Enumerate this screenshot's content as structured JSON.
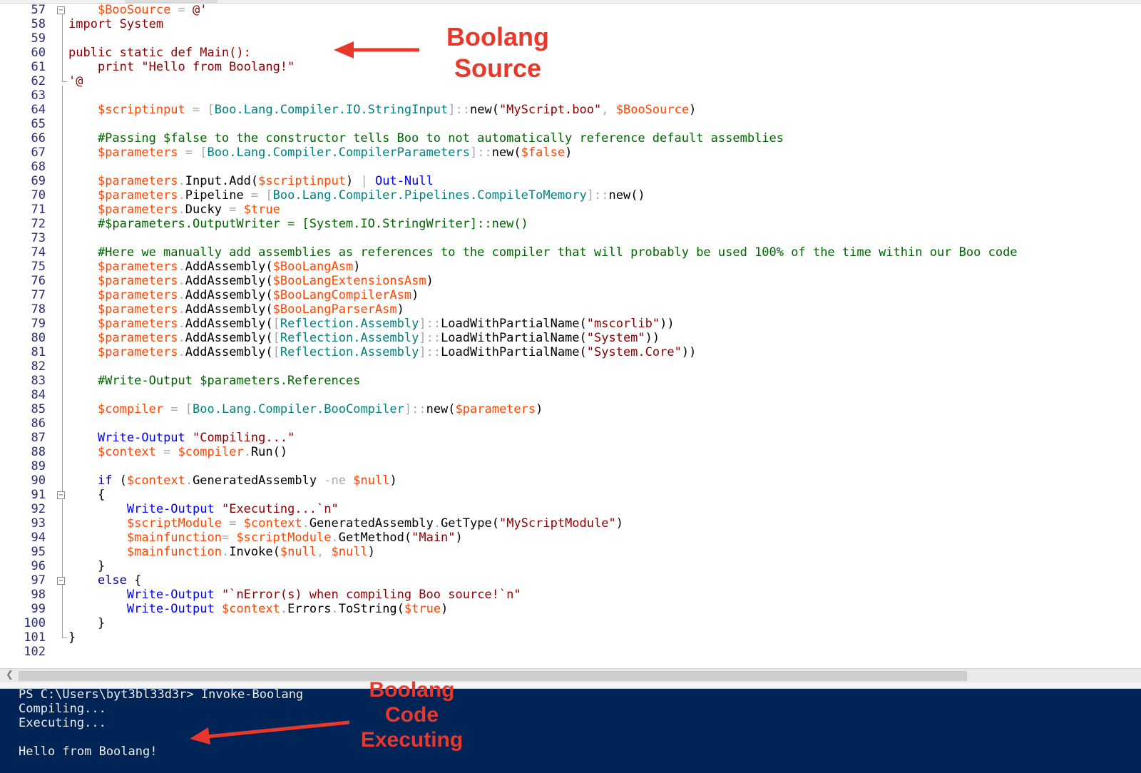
{
  "editor": {
    "line_numbers": [
      "57",
      "58",
      "59",
      "60",
      "61",
      "62",
      "63",
      "64",
      "65",
      "66",
      "67",
      "68",
      "69",
      "70",
      "71",
      "72",
      "73",
      "74",
      "75",
      "76",
      "77",
      "78",
      "79",
      "80",
      "81",
      "82",
      "83",
      "84",
      "85",
      "86",
      "87",
      "88",
      "89",
      "90",
      "91",
      "92",
      "93",
      "94",
      "95",
      "96",
      "97",
      "98",
      "99",
      "100",
      "101",
      "102"
    ],
    "lines": [
      [
        [
          "    ",
          "m"
        ],
        [
          "$BooSource",
          "v"
        ],
        [
          " = ",
          "o"
        ],
        [
          "@'",
          "s"
        ]
      ],
      [
        [
          "import System",
          "s"
        ]
      ],
      [
        [
          "",
          "m"
        ]
      ],
      [
        [
          "public static def Main():",
          "s"
        ]
      ],
      [
        [
          "    print \"Hello from Boolang!\"",
          "s"
        ]
      ],
      [
        [
          "'@",
          "s"
        ]
      ],
      [
        [
          "",
          "m"
        ]
      ],
      [
        [
          "    ",
          "m"
        ],
        [
          "$scriptinput",
          "v"
        ],
        [
          " = ",
          "o"
        ],
        [
          "[",
          "o"
        ],
        [
          "Boo.Lang.Compiler.IO.StringInput",
          "t"
        ],
        [
          "]::",
          "o"
        ],
        [
          "new(",
          "m"
        ],
        [
          "\"MyScript.boo\"",
          "s"
        ],
        [
          ", ",
          "o"
        ],
        [
          "$BooSource",
          "v"
        ],
        [
          ")",
          "m"
        ]
      ],
      [
        [
          "",
          "m"
        ]
      ],
      [
        [
          "    #Passing $false to the constructor tells Boo to not automatically reference default assemblies",
          "c"
        ]
      ],
      [
        [
          "    ",
          "m"
        ],
        [
          "$parameters",
          "v"
        ],
        [
          " = ",
          "o"
        ],
        [
          "[",
          "o"
        ],
        [
          "Boo.Lang.Compiler.CompilerParameters",
          "t"
        ],
        [
          "]::",
          "o"
        ],
        [
          "new(",
          "m"
        ],
        [
          "$false",
          "v"
        ],
        [
          ")",
          "m"
        ]
      ],
      [
        [
          "",
          "m"
        ]
      ],
      [
        [
          "    ",
          "m"
        ],
        [
          "$parameters",
          "v"
        ],
        [
          ".",
          "o"
        ],
        [
          "Input.Add(",
          "m"
        ],
        [
          "$scriptinput",
          "v"
        ],
        [
          ")",
          "m"
        ],
        [
          " | ",
          "o"
        ],
        [
          "Out-Null",
          "cm"
        ]
      ],
      [
        [
          "    ",
          "m"
        ],
        [
          "$parameters",
          "v"
        ],
        [
          ".",
          "o"
        ],
        [
          "Pipeline",
          "m"
        ],
        [
          " = ",
          "o"
        ],
        [
          "[",
          "o"
        ],
        [
          "Boo.Lang.Compiler.Pipelines.CompileToMemory",
          "t"
        ],
        [
          "]::",
          "o"
        ],
        [
          "new()",
          "m"
        ]
      ],
      [
        [
          "    ",
          "m"
        ],
        [
          "$parameters",
          "v"
        ],
        [
          ".",
          "o"
        ],
        [
          "Ducky",
          "m"
        ],
        [
          " = ",
          "o"
        ],
        [
          "$true",
          "v"
        ]
      ],
      [
        [
          "    #$parameters.OutputWriter = [System.IO.StringWriter]::new()",
          "c"
        ]
      ],
      [
        [
          "",
          "m"
        ]
      ],
      [
        [
          "    #Here we manually add assemblies as references to the compiler that will probably be used 100% of the time within our Boo code",
          "c"
        ]
      ],
      [
        [
          "    ",
          "m"
        ],
        [
          "$parameters",
          "v"
        ],
        [
          ".",
          "o"
        ],
        [
          "AddAssembly(",
          "m"
        ],
        [
          "$BooLangAsm",
          "v"
        ],
        [
          ")",
          "m"
        ]
      ],
      [
        [
          "    ",
          "m"
        ],
        [
          "$parameters",
          "v"
        ],
        [
          ".",
          "o"
        ],
        [
          "AddAssembly(",
          "m"
        ],
        [
          "$BooLangExtensionsAsm",
          "v"
        ],
        [
          ")",
          "m"
        ]
      ],
      [
        [
          "    ",
          "m"
        ],
        [
          "$parameters",
          "v"
        ],
        [
          ".",
          "o"
        ],
        [
          "AddAssembly(",
          "m"
        ],
        [
          "$BooLangCompilerAsm",
          "v"
        ],
        [
          ")",
          "m"
        ]
      ],
      [
        [
          "    ",
          "m"
        ],
        [
          "$parameters",
          "v"
        ],
        [
          ".",
          "o"
        ],
        [
          "AddAssembly(",
          "m"
        ],
        [
          "$BooLangParserAsm",
          "v"
        ],
        [
          ")",
          "m"
        ]
      ],
      [
        [
          "    ",
          "m"
        ],
        [
          "$parameters",
          "v"
        ],
        [
          ".",
          "o"
        ],
        [
          "AddAssembly(",
          "m"
        ],
        [
          "[",
          "o"
        ],
        [
          "Reflection.Assembly",
          "t"
        ],
        [
          "]::",
          "o"
        ],
        [
          "LoadWithPartialName(",
          "m"
        ],
        [
          "\"mscorlib\"",
          "s"
        ],
        [
          "))",
          "m"
        ]
      ],
      [
        [
          "    ",
          "m"
        ],
        [
          "$parameters",
          "v"
        ],
        [
          ".",
          "o"
        ],
        [
          "AddAssembly(",
          "m"
        ],
        [
          "[",
          "o"
        ],
        [
          "Reflection.Assembly",
          "t"
        ],
        [
          "]::",
          "o"
        ],
        [
          "LoadWithPartialName(",
          "m"
        ],
        [
          "\"System\"",
          "s"
        ],
        [
          "))",
          "m"
        ]
      ],
      [
        [
          "    ",
          "m"
        ],
        [
          "$parameters",
          "v"
        ],
        [
          ".",
          "o"
        ],
        [
          "AddAssembly(",
          "m"
        ],
        [
          "[",
          "o"
        ],
        [
          "Reflection.Assembly",
          "t"
        ],
        [
          "]::",
          "o"
        ],
        [
          "LoadWithPartialName(",
          "m"
        ],
        [
          "\"System.Core\"",
          "s"
        ],
        [
          "))",
          "m"
        ]
      ],
      [
        [
          "",
          "m"
        ]
      ],
      [
        [
          "    #Write-Output $parameters.References",
          "c"
        ]
      ],
      [
        [
          "",
          "m"
        ]
      ],
      [
        [
          "    ",
          "m"
        ],
        [
          "$compiler",
          "v"
        ],
        [
          " = ",
          "o"
        ],
        [
          "[",
          "o"
        ],
        [
          "Boo.Lang.Compiler.BooCompiler",
          "t"
        ],
        [
          "]::",
          "o"
        ],
        [
          "new(",
          "m"
        ],
        [
          "$parameters",
          "v"
        ],
        [
          ")",
          "m"
        ]
      ],
      [
        [
          "",
          "m"
        ]
      ],
      [
        [
          "    ",
          "m"
        ],
        [
          "Write-Output",
          "cm"
        ],
        [
          " ",
          "m"
        ],
        [
          "\"Compiling...\"",
          "s"
        ]
      ],
      [
        [
          "    ",
          "m"
        ],
        [
          "$context",
          "v"
        ],
        [
          " = ",
          "o"
        ],
        [
          "$compiler",
          "v"
        ],
        [
          ".",
          "o"
        ],
        [
          "Run()",
          "m"
        ]
      ],
      [
        [
          "",
          "m"
        ]
      ],
      [
        [
          "    ",
          "m"
        ],
        [
          "if",
          "k"
        ],
        [
          " (",
          "m"
        ],
        [
          "$context",
          "v"
        ],
        [
          ".",
          "o"
        ],
        [
          "GeneratedAssembly ",
          "m"
        ],
        [
          "-ne",
          "o"
        ],
        [
          " ",
          "m"
        ],
        [
          "$null",
          "v"
        ],
        [
          ")",
          "m"
        ]
      ],
      [
        [
          "    {",
          "m"
        ]
      ],
      [
        [
          "        ",
          "m"
        ],
        [
          "Write-Output",
          "cm"
        ],
        [
          " ",
          "m"
        ],
        [
          "\"Executing...`n\"",
          "s"
        ]
      ],
      [
        [
          "        ",
          "m"
        ],
        [
          "$scriptModule",
          "v"
        ],
        [
          " = ",
          "o"
        ],
        [
          "$context",
          "v"
        ],
        [
          ".",
          "o"
        ],
        [
          "GeneratedAssembly",
          "m"
        ],
        [
          ".",
          "o"
        ],
        [
          "GetType(",
          "m"
        ],
        [
          "\"MyScriptModule\"",
          "s"
        ],
        [
          ")",
          "m"
        ]
      ],
      [
        [
          "        ",
          "m"
        ],
        [
          "$mainfunction",
          "v"
        ],
        [
          "= ",
          "o"
        ],
        [
          "$scriptModule",
          "v"
        ],
        [
          ".",
          "o"
        ],
        [
          "GetMethod(",
          "m"
        ],
        [
          "\"Main\"",
          "s"
        ],
        [
          ")",
          "m"
        ]
      ],
      [
        [
          "        ",
          "m"
        ],
        [
          "$mainfunction",
          "v"
        ],
        [
          ".",
          "o"
        ],
        [
          "Invoke(",
          "m"
        ],
        [
          "$null",
          "v"
        ],
        [
          ", ",
          "o"
        ],
        [
          "$null",
          "v"
        ],
        [
          ")",
          "m"
        ]
      ],
      [
        [
          "    }",
          "m"
        ]
      ],
      [
        [
          "    ",
          "m"
        ],
        [
          "else",
          "k"
        ],
        [
          " {",
          "m"
        ]
      ],
      [
        [
          "        ",
          "m"
        ],
        [
          "Write-Output",
          "cm"
        ],
        [
          " ",
          "m"
        ],
        [
          "\"`nError(s) when compiling Boo source!`n\"",
          "s"
        ]
      ],
      [
        [
          "        ",
          "m"
        ],
        [
          "Write-Output",
          "cm"
        ],
        [
          " ",
          "m"
        ],
        [
          "$context",
          "v"
        ],
        [
          ".",
          "o"
        ],
        [
          "Errors",
          "m"
        ],
        [
          ".",
          "o"
        ],
        [
          "ToString(",
          "m"
        ],
        [
          "$true",
          "v"
        ],
        [
          ")",
          "m"
        ]
      ],
      [
        [
          "    }",
          "m"
        ]
      ],
      [
        [
          "}",
          "m"
        ]
      ],
      [
        [
          "",
          "m"
        ]
      ]
    ]
  },
  "console": {
    "lines": [
      "PS C:\\Users\\byt3bl33d3r> Invoke-Boolang",
      "Compiling...",
      "Executing...",
      "",
      "Hello from Boolang!"
    ]
  },
  "annotations": {
    "source_label": [
      "Boolang",
      "Source"
    ],
    "exec_label": [
      "Boolang",
      "Code",
      "Executing"
    ],
    "color": "#e8382b"
  },
  "colors": {
    "console_bg": "#012456",
    "variable": "#ff4500",
    "type": "#008080",
    "string": "#8b0000",
    "comment": "#006400",
    "keyword": "#00008b",
    "command": "#0000ff"
  }
}
